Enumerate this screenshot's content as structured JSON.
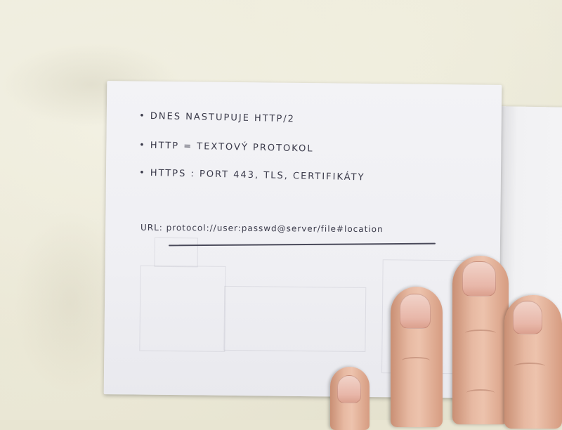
{
  "notes": {
    "bullets": [
      "• DNES NASTUPUJE HTTP/2",
      "• HTTP = TEXTOVÝ PROTOKOL",
      "• HTTPS : PORT 443, TLS, CERTIFIKÁTY"
    ],
    "url_line": "URL: protocol://user:passwd@server/file#location"
  },
  "colors": {
    "ink": "#3a3a4a",
    "paper": "#f1f1f4",
    "sheet": "#e8e5d2",
    "skin": "#e7b9a2"
  }
}
